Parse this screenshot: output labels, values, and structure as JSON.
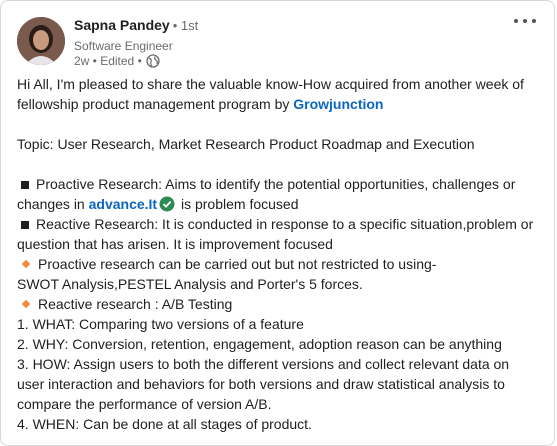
{
  "author": {
    "name": "Sapna Pandey",
    "degree": "• 1st",
    "headline": "Software Engineer",
    "meta": "2w • Edited •",
    "globe_icon": "globe-icon"
  },
  "more_icon": "ellipsis-icon",
  "colors": {
    "link": "#0a66c2",
    "diamond": "#f5883b",
    "check": "#2e8b57"
  },
  "post": {
    "intro_1": "Hi All, I'm pleased to share the valuable know-How acquired from another week of",
    "intro_2": "fellowship product management program by ",
    "intro_link": "Growjunction",
    "topic": "Topic: User Research, Market Research Product Roadmap and Execution",
    "proactive_1": "Proactive Research: Aims to identify the potential opportunities, challenges or",
    "proactive_2a": "changes in ",
    "proactive_link": "advance.It",
    "proactive_2b": " is problem focused",
    "reactive_1": "Reactive Research: It is conducted in response to a specific situation,problem or",
    "reactive_2": "question that has arisen. It is improvement focused",
    "proactive_tools_1": "Proactive research can be carried out but not restricted to using-",
    "proactive_tools_2": "SWOT Analysis,PESTEL Analysis and Porter's 5 forces.",
    "reactive_ab": "Reactive research : A/B Testing",
    "what": "1. WHAT: Comparing two versions of a feature",
    "why": "2. WHY: Conversion, retention, engagement, adoption reason can be anything",
    "how_1": "3. HOW: Assign users to both the different versions and collect relevant data on",
    "how_2": "user interaction and behaviors for both versions and draw statistical analysis to",
    "how_3": "compare the performance of version A/B.",
    "when": "4. WHEN: Can be done at all stages of product."
  }
}
